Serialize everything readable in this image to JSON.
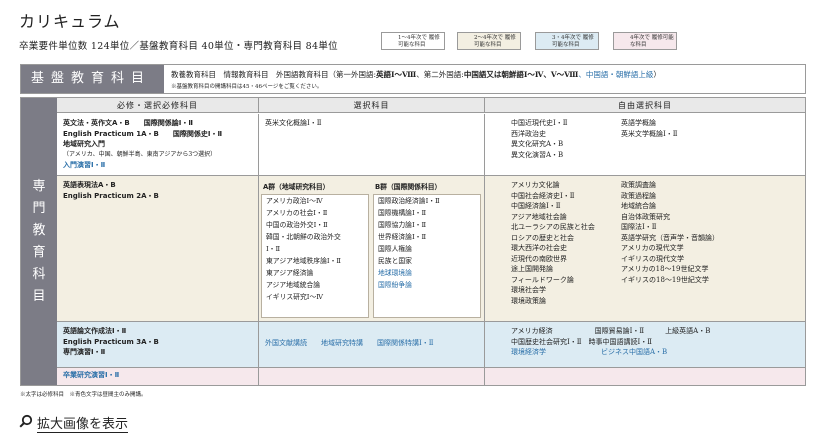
{
  "page": {
    "title": "カリキュラム",
    "units": "卒業要件単位数 124単位／基盤教育科目 40単位・専門教育科目 84単位"
  },
  "legend": [
    {
      "text": "1～4年次で 履修可能な科目",
      "color": "#ffffff"
    },
    {
      "text": "2～4年次で 履修可能な科目",
      "color": "#f3efe2"
    },
    {
      "text": "3・4年次で 履修可能な科目",
      "color": "#dcebf3"
    },
    {
      "text": "4年次で 履修可能な科目",
      "color": "#f6e8ec"
    }
  ],
  "kiso": {
    "label": "基盤教育科目",
    "text_a": "教養教育科目　情報教育科目　外国語教育科目（第一外国語:",
    "text_b": "英語Ⅰ～Ⅷ",
    "text_c": "、第二外国語:",
    "text_d": "中国語又は朝鮮語Ⅰ～Ⅳ、Ⅴ～Ⅷ",
    "text_e": "、中国語・朝鮮語上級",
    "text_f": "）",
    "note": "※基盤教育科目の開講科目は45・46ページをご覧ください。"
  },
  "senmon": {
    "label": [
      "専",
      "門",
      "教",
      "育",
      "科",
      "目"
    ]
  },
  "headers": {
    "required": "必修・選択必修科目",
    "elective": "選択科目",
    "free": "自由選択科目"
  },
  "row1": {
    "req": [
      "英文法・英作文A・B　　国際関係論Ⅰ・Ⅱ",
      "English Practicum 1A・B　　国際関係史Ⅰ・Ⅱ",
      "地域研究入門",
      "（アメリカ、中国、朝鮮半島、東南アジアから3つ選択）",
      "入門演習Ⅰ・Ⅱ"
    ],
    "elective": "英米文化概論Ⅰ・Ⅱ",
    "free_left": [
      "中国近現代史Ⅰ・Ⅱ",
      "西洋政治史",
      "異文化研究A・B",
      "異文化演習A・B"
    ],
    "free_right": [
      "英語学概論",
      "英米文学概論Ⅰ・Ⅱ"
    ]
  },
  "row2": {
    "req": [
      "英語表現法A・B",
      "English Practicum 2A・B"
    ],
    "groupA_title": "A群（地域研究科目）",
    "groupA": [
      "アメリカ政治Ⅰ～Ⅳ",
      "アメリカの社会Ⅰ・Ⅱ",
      "中国の政治外交Ⅰ・Ⅱ",
      "韓国・北朝鮮の政治外交",
      "Ⅰ・Ⅱ",
      "東アジア地域秩序論Ⅰ・Ⅱ",
      "東アジア経済論",
      "アジア地域統合論",
      "イギリス研究Ⅰ～Ⅳ"
    ],
    "groupB_title": "B群（国際関係科目）",
    "groupB": [
      "国際政治経済論Ⅰ・Ⅱ",
      "国際機構論Ⅰ・Ⅱ",
      "国際協力論Ⅰ・Ⅱ",
      "世界経済論Ⅰ・Ⅱ",
      "国際人権論",
      "民族と国家"
    ],
    "groupB_blue": [
      "地球環境論",
      "国際紛争論"
    ],
    "free_left": [
      "アメリカ文化論",
      "中国社会経済史Ⅰ・Ⅱ",
      "中国経済論Ⅰ・Ⅱ",
      "アジア地域社会論",
      "北ユーラシアの民族と社会",
      "ロシアの歴史と社会",
      "環大西洋の社会史",
      "近現代の南欧世界",
      "途上国開発論",
      "フィールドワーク論",
      "環境社会学",
      "環境政策論"
    ],
    "free_right": [
      "政策調査論",
      "政策過程論",
      "地域統合論",
      "自治体政策研究",
      "国際法Ⅰ・Ⅱ",
      "英語学研究（音声学・音韻論）",
      "アメリカの現代文学",
      "イギリスの現代文学",
      "アメリカの18～19世紀文学",
      "イギリスの18～19世紀文学"
    ]
  },
  "row3": {
    "req": [
      "英語論文作成法Ⅰ・Ⅱ",
      "English Practicum 3A・B",
      "専門演習Ⅰ・Ⅱ"
    ],
    "elective": "外国文献講読　　地域研究特講　　国際関係特講Ⅰ・Ⅱ",
    "free_line1": "アメリカ経済　　　　　　国際貿易論Ⅰ・Ⅱ　　　上級英語A・B",
    "free_line2a": "中国歴史社会研究Ⅰ・Ⅱ　時事中国語講読Ⅰ・Ⅱ",
    "free_line3a": "環境経済学",
    "free_line3b": "ビジネス中国語A・B"
  },
  "row4": {
    "req": "卒業研究演習Ⅰ・Ⅱ"
  },
  "footnote": "※太字は必修科目　※青色文字は昼間主のみ開講。",
  "zoom": {
    "label": "拡大画像を表示",
    "icon": "search-icon"
  }
}
